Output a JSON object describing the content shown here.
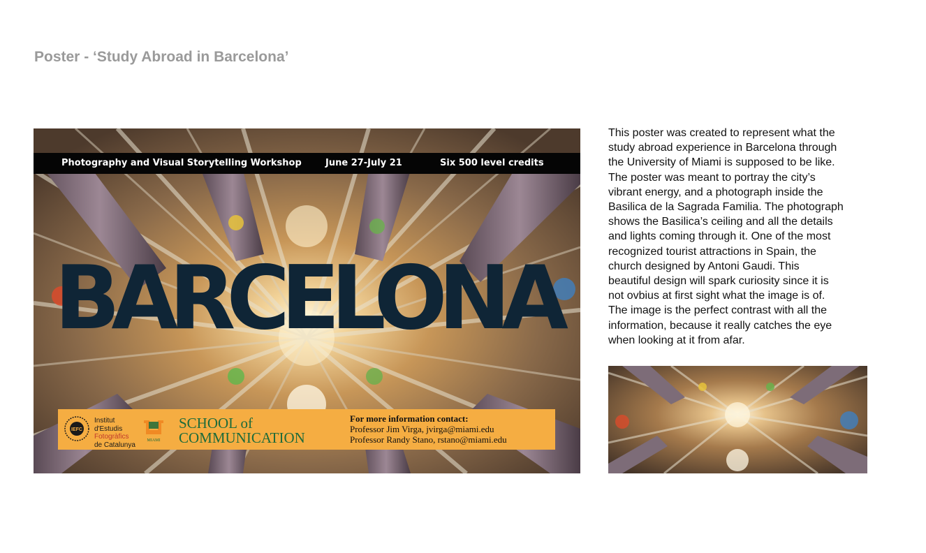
{
  "page": {
    "title": "Poster - ‘Study Abroad in Barcelona’"
  },
  "poster": {
    "top_bar": {
      "workshop": "Photography and Visual Storytelling Workshop",
      "dates": "June 27-July 21",
      "credits": "Six 500 level credits"
    },
    "headline": "BARCELONA",
    "bottom_bar": {
      "iefc_seal_text": "IEFC",
      "iefc_name": [
        "Institut",
        "d'Estudis",
        "Fotogràfics",
        "de Catalunya"
      ],
      "um_logo_text": "MIAMI",
      "school_lines": [
        "SCHOOL of",
        "COMMUNICATION"
      ],
      "contact_heading": "For more information contact:",
      "contacts": [
        "Professor Jim Virga, jvirga@miami.edu",
        "Professor Randy Stano, rstano@miami.edu"
      ]
    },
    "colors": {
      "headline": "#0f2536",
      "banner": "#f5ad42",
      "school_green": "#1e6b3a",
      "top_bar": "#050505"
    }
  },
  "description": {
    "lines": [
      "This poster was created to represent what the",
      "study abroad experience in Barcelona through",
      "the University of Miami is supposed to be like.",
      "The poster was meant to portray the city’s",
      "vibrant energy, and a photograph inside the",
      "Basilica de la Sagrada Familia. The photograph",
      "shows the Basilica’s  ceiling and all the details",
      "and lights coming through it. One of the most",
      "recognized tourist attractions in Spain, the",
      "church designed by Antoni Gaudi. This",
      "beautiful design will spark curiosity since it is",
      "not ovbius at first sight what the image is of.",
      "The image is the perfect contrast with all the",
      "information, because it really catches the eye",
      "when looking at it from afar."
    ]
  },
  "thumbnail": {
    "subject": "Sagrada Familia ceiling photograph"
  }
}
